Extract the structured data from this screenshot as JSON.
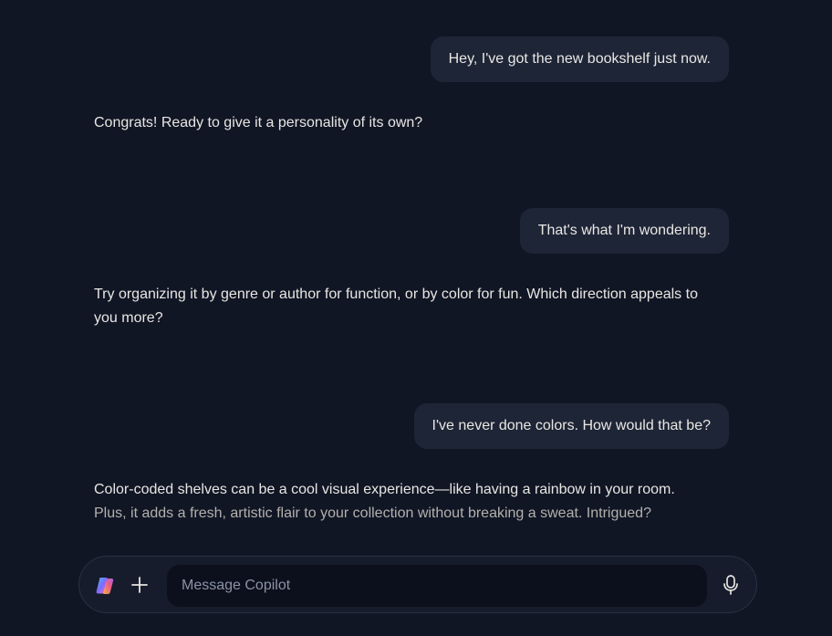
{
  "conversation": {
    "messages": [
      {
        "role": "user",
        "text": "Hey, I've got the new bookshelf just now."
      },
      {
        "role": "assistant",
        "text": "Congrats! Ready to give it a personality of its own?"
      },
      {
        "role": "user",
        "text": "That's what I'm wondering."
      },
      {
        "role": "assistant",
        "text": "Try organizing it by genre or author for function, or by color for fun. Which direction appeals to you more?"
      },
      {
        "role": "user",
        "text": "I've never done colors. How would that be?"
      },
      {
        "role": "assistant",
        "text_line1": "Color-coded shelves can be a cool visual experience—like having a rainbow in your room.",
        "text_line2": "Plus, it adds a fresh, artistic flair to your collection without breaking a sweat. Intrigued?"
      }
    ]
  },
  "composer": {
    "placeholder": "Message Copilot",
    "value": "",
    "logo_icon": "copilot-logo-icon",
    "add_icon": "plus-icon",
    "mic_icon": "microphone-icon"
  },
  "colors": {
    "background": "#111625",
    "user_bubble": "#1e2536",
    "input_field": "#0c101c",
    "text": "#e8e6e3",
    "placeholder": "#8a93a6"
  }
}
